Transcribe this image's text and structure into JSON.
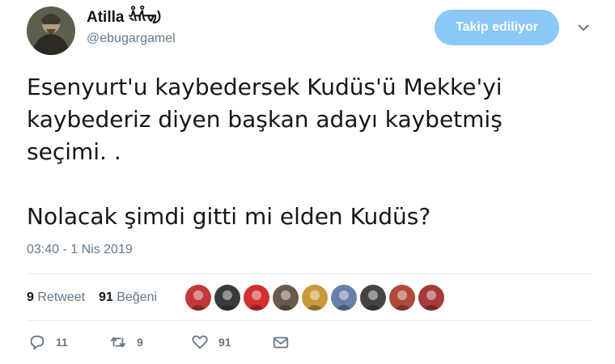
{
  "user": {
    "display_name": "Atilla ᢤᢥᢦᢧ",
    "handle": "@ebugargamel"
  },
  "follow_button": {
    "label": "Takip ediliyor",
    "color": "#8ac8f5"
  },
  "tweet": {
    "text": "Esenyurt'u kaybedersek Kudüs'ü Mekke'yi\nkaybederiz diyen başkan adayı kaybetmiş\nseçimi. .\n\nNolacak şimdi gitti mi elden Kudüs?",
    "timestamp": "03:40 - 1 Nis 2019"
  },
  "stats": {
    "retweet_count": "9",
    "retweet_label": "Retweet",
    "like_count": "91",
    "like_label": "Beğeni"
  },
  "likers": [
    {
      "name": "liker-avatar-1",
      "color": "#c23a3a"
    },
    {
      "name": "liker-avatar-2",
      "color": "#3a3a3a"
    },
    {
      "name": "liker-avatar-3",
      "color": "#d22f2f"
    },
    {
      "name": "liker-avatar-4",
      "color": "#6b5a4a"
    },
    {
      "name": "liker-avatar-5",
      "color": "#c89a3a"
    },
    {
      "name": "liker-avatar-6",
      "color": "#6a7fa8"
    },
    {
      "name": "liker-avatar-7",
      "color": "#444444"
    },
    {
      "name": "liker-avatar-8",
      "color": "#b04a3a"
    },
    {
      "name": "liker-avatar-9",
      "color": "#a53a3a"
    }
  ],
  "actions": {
    "reply_count": "11",
    "retweet_count": "9",
    "like_count": "91"
  },
  "colors": {
    "secondary_text": "#657786",
    "divider": "#e6ecf0"
  }
}
